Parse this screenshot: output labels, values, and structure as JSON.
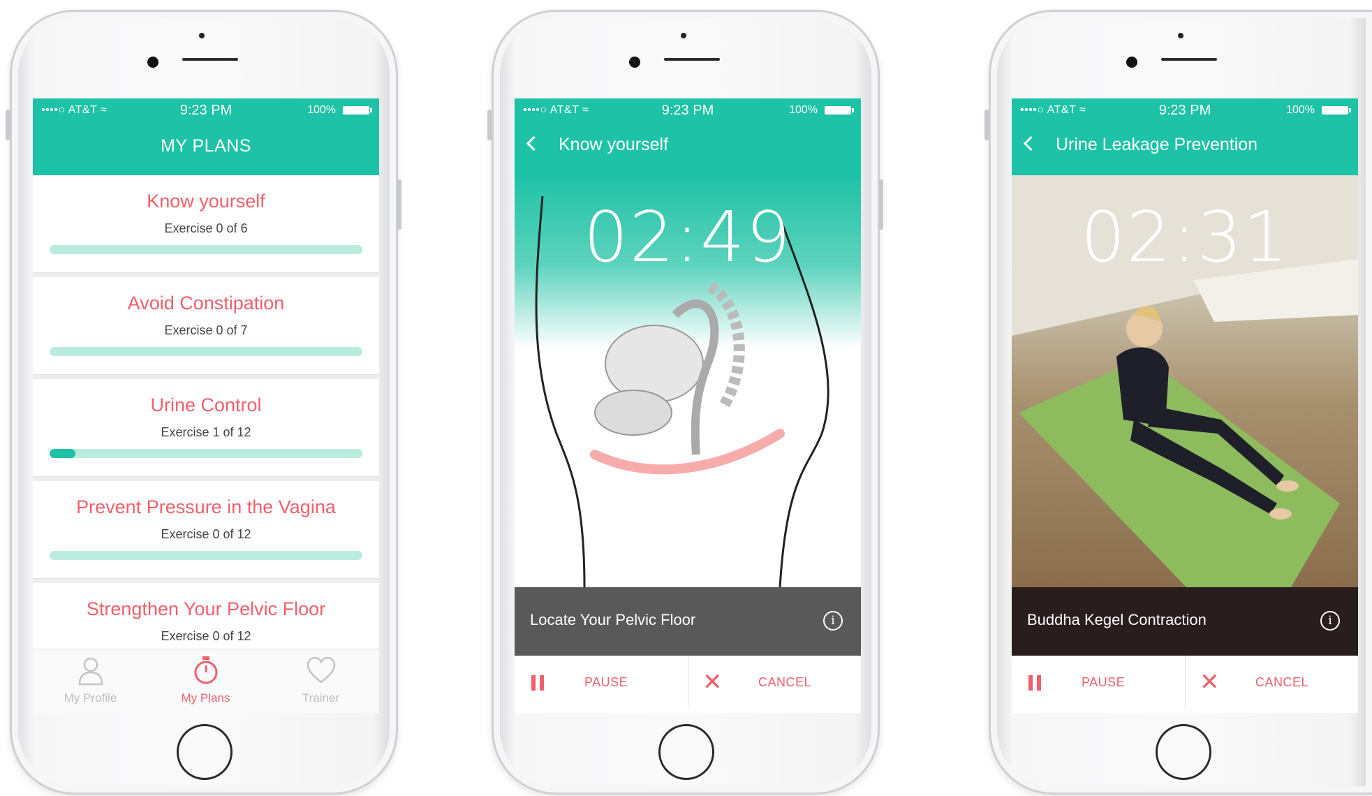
{
  "status_bar": {
    "carrier": "••••○ AT&T ≈",
    "time": "9:23 PM",
    "battery": "100%"
  },
  "screen1": {
    "header_title": "MY PLANS",
    "plans": [
      {
        "title": "Know yourself",
        "subtitle": "Exercise 0 of 6",
        "progress": 0
      },
      {
        "title": "Avoid Constipation",
        "subtitle": "Exercise 0 of 7",
        "progress": 0
      },
      {
        "title": "Urine Control",
        "subtitle": "Exercise 1 of 12",
        "progress": 0.083
      },
      {
        "title": "Prevent Pressure in the Vagina",
        "subtitle": "Exercise 0 of 12",
        "progress": 0
      },
      {
        "title": "Strengthen Your Pelvic Floor",
        "subtitle": "Exercise 0 of 12",
        "progress": 0
      }
    ],
    "tabs": [
      {
        "label": "My Profile",
        "icon": "profile-icon",
        "active": false
      },
      {
        "label": "My Plans",
        "icon": "stopwatch-icon",
        "active": true
      },
      {
        "label": "Trainer",
        "icon": "heart-icon",
        "active": false
      }
    ]
  },
  "screen2": {
    "header_title": "Know yourself",
    "timer": "02:49",
    "caption": "Locate Your Pelvic Floor",
    "pause_label": "PAUSE",
    "cancel_label": "CANCEL"
  },
  "screen3": {
    "header_title": "Urine Leakage Prevention",
    "timer": "02:31",
    "caption": "Buddha Kegel Contraction",
    "pause_label": "PAUSE",
    "cancel_label": "CANCEL"
  },
  "colors": {
    "teal": "#1ec2a6",
    "coral": "#f0606b",
    "track": "#b9ecde"
  }
}
